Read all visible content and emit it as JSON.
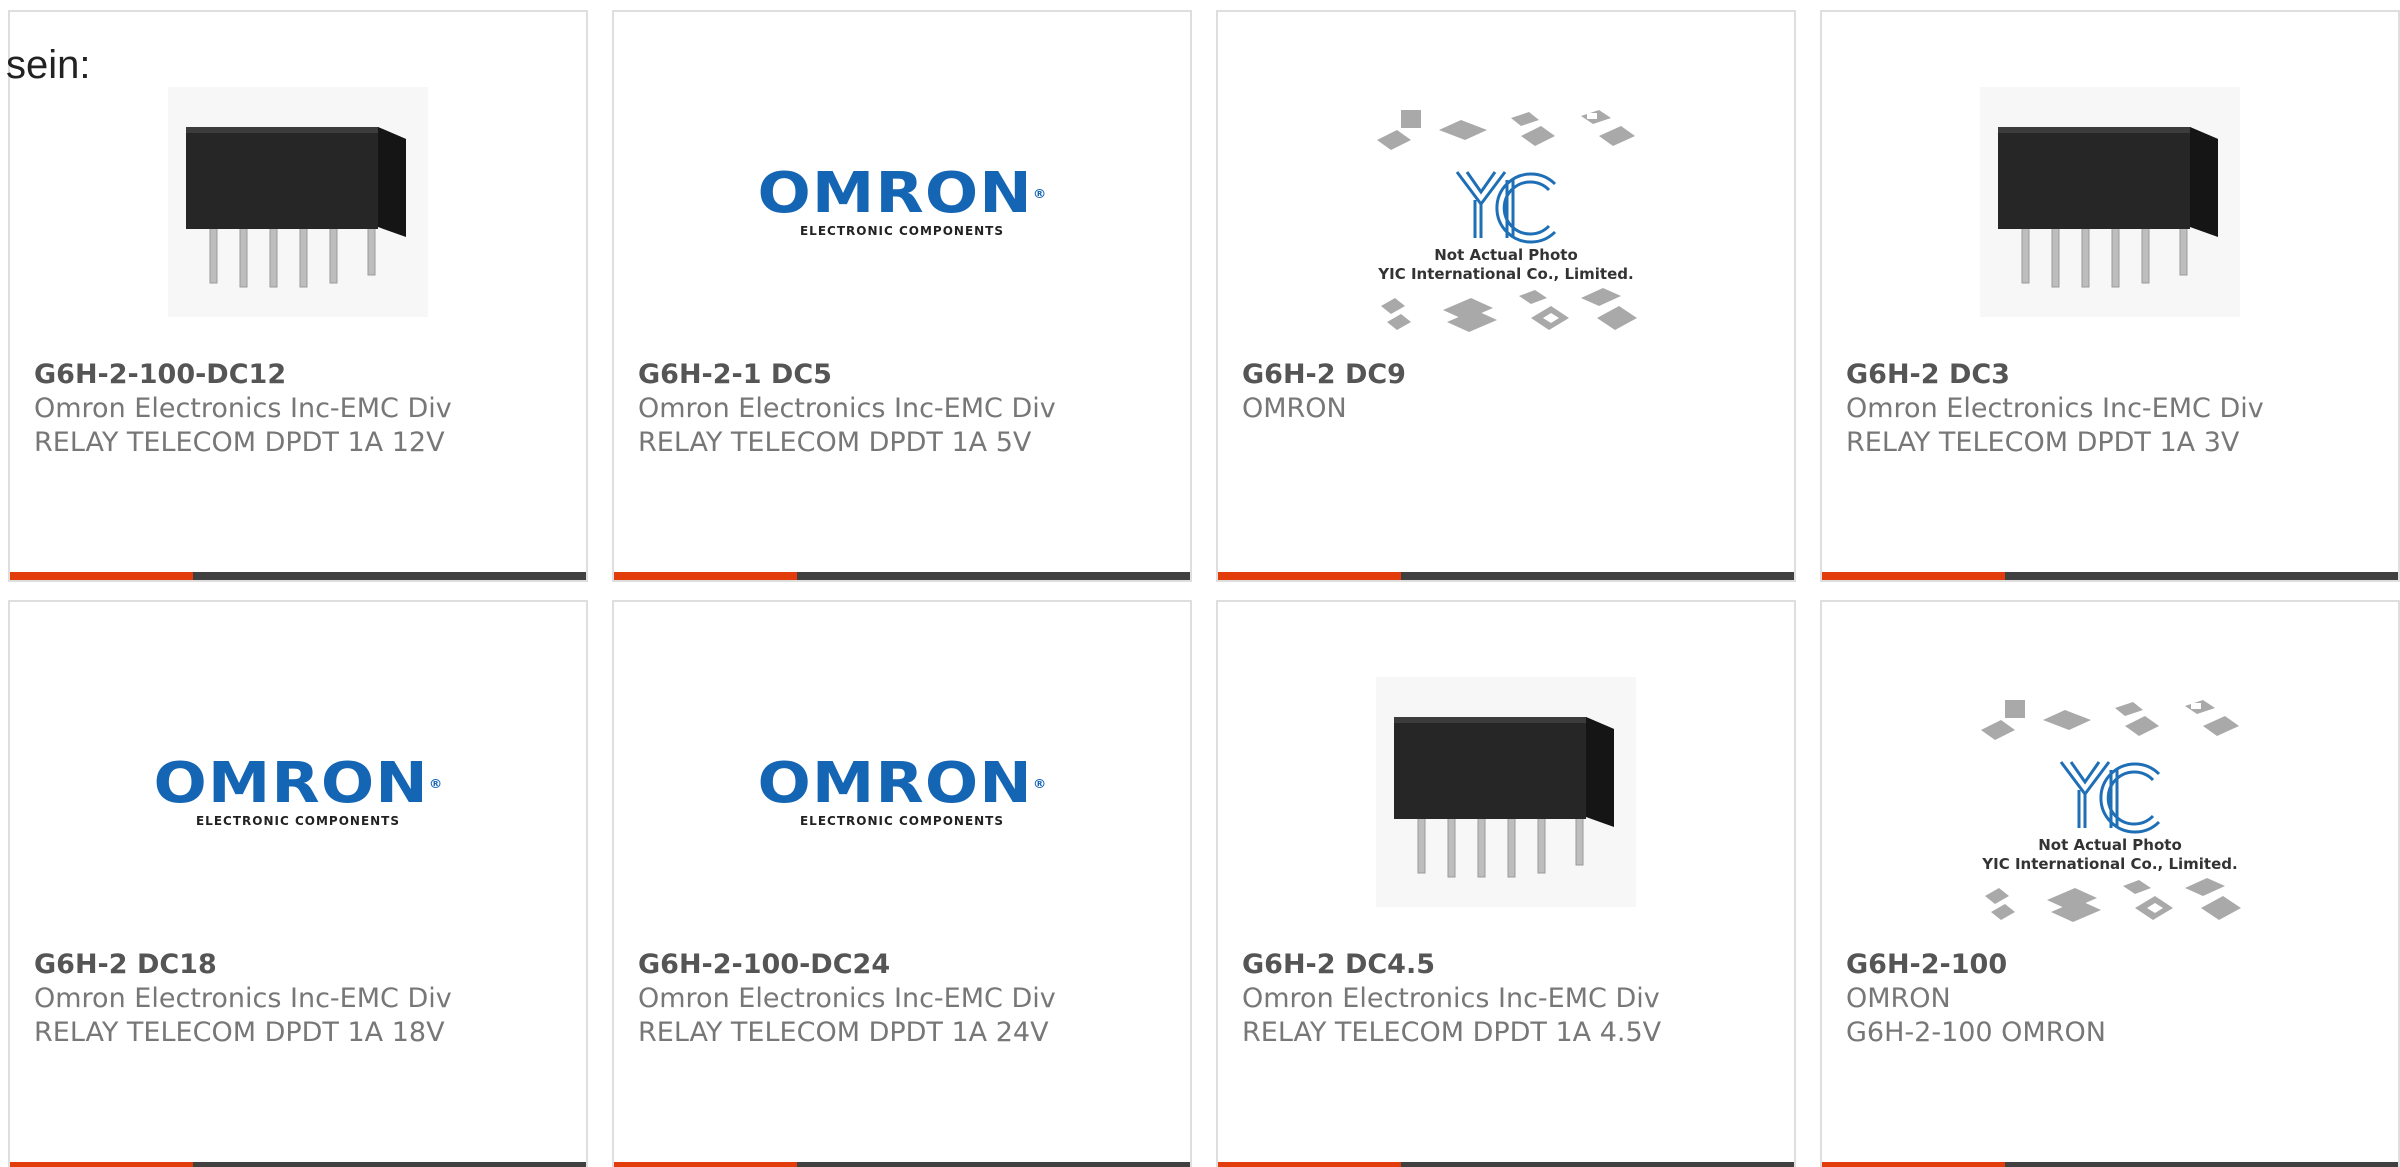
{
  "intro_text": "sein:",
  "colors": {
    "accent": "#e23c0b",
    "bar": "#404040",
    "omron_blue": "#1565b5",
    "border": "#dedede"
  },
  "logos": {
    "omron_word": "OMRON",
    "omron_reg": "®",
    "omron_sub": "ELECTRONIC COMPONENTS",
    "yic_caption_1": "Not Actual Photo",
    "yic_caption_2": "YIC International Co., Limited."
  },
  "products": [
    {
      "part": "G6H-2-100-DC12",
      "maker": "Omron Electronics Inc-EMC Div",
      "desc": "RELAY TELECOM DPDT 1A 12V",
      "image": "relay-photo"
    },
    {
      "part": "G6H-2-1 DC5",
      "maker": "Omron Electronics Inc-EMC Div",
      "desc": "RELAY TELECOM DPDT 1A 5V",
      "image": "omron-logo"
    },
    {
      "part": "G6H-2 DC9",
      "maker": "OMRON",
      "desc": "",
      "image": "yic-placeholder"
    },
    {
      "part": "G6H-2 DC3",
      "maker": "Omron Electronics Inc-EMC Div",
      "desc": "RELAY TELECOM DPDT 1A 3V",
      "image": "relay-photo"
    },
    {
      "part": "G6H-2 DC18",
      "maker": "Omron Electronics Inc-EMC Div",
      "desc": "RELAY TELECOM DPDT 1A 18V",
      "image": "omron-logo"
    },
    {
      "part": "G6H-2-100-DC24",
      "maker": "Omron Electronics Inc-EMC Div",
      "desc": "RELAY TELECOM DPDT 1A 24V",
      "image": "omron-logo"
    },
    {
      "part": "G6H-2 DC4.5",
      "maker": "Omron Electronics Inc-EMC Div",
      "desc": "RELAY TELECOM DPDT 1A 4.5V",
      "image": "relay-photo"
    },
    {
      "part": "G6H-2-100",
      "maker": "OMRON",
      "desc": "G6H-2-100 OMRON",
      "image": "yic-placeholder"
    }
  ]
}
